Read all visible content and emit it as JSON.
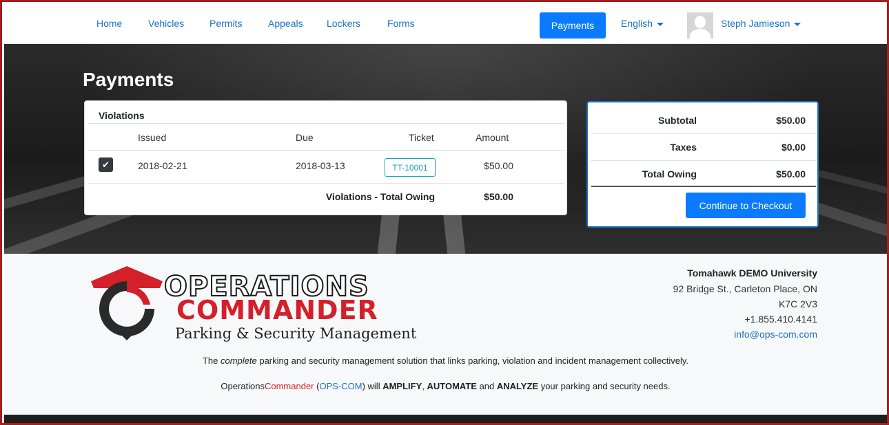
{
  "nav": {
    "links": [
      "Home",
      "Vehicles",
      "Permits",
      "Appeals",
      "Lockers",
      "Forms"
    ],
    "active": "Payments",
    "language": "English",
    "user": "Steph Jamieson"
  },
  "page": {
    "title": "Payments"
  },
  "violations": {
    "heading": "Violations",
    "columns": [
      "Issued",
      "Due",
      "Ticket",
      "Amount"
    ],
    "rows": [
      {
        "checked": true,
        "issued": "2018-02-21",
        "due": "2018-03-13",
        "ticket": "TT-10001",
        "amount": "$50.00"
      }
    ],
    "total_label": "Violations - Total Owing",
    "total_value": "$50.00"
  },
  "summary": {
    "subtotal_label": "Subtotal",
    "subtotal": "$50.00",
    "taxes_label": "Taxes",
    "taxes": "$0.00",
    "total_label": "Total Owing",
    "total": "$50.00",
    "checkout_label": "Continue to Checkout"
  },
  "footer": {
    "logo_line1": "OPERATIONS",
    "logo_line2": "COMMANDER",
    "logo_tagline": "Parking & Security Management",
    "org": "Tomahawk DEMO University",
    "address1": "92 Bridge St., Carleton Place, ON",
    "address2": "K7C 2V3",
    "phone": "+1.855.410.4141",
    "email": "info@ops-com.com",
    "tagline_pre": "The ",
    "tagline_em": "complete",
    "tagline_post": " parking and security management solution that links parking, violation and incident management collectively.",
    "amp_operations": "Operations",
    "amp_commander": "Commander",
    "amp_open": " (",
    "amp_opscom": "OPS-COM",
    "amp_will": ") will ",
    "amp_amplify": "AMPLIFY",
    "amp_comma": ", ",
    "amp_automate": "AUTOMATE",
    "amp_and": " and ",
    "amp_analyze": "ANALYZE",
    "amp_end": " your parking and security needs."
  },
  "colors": {
    "primary": "#0a7bff",
    "link": "#1a73c9",
    "info": "#17a2b8",
    "brand_red": "#d4202a",
    "frame": "#a32020"
  }
}
